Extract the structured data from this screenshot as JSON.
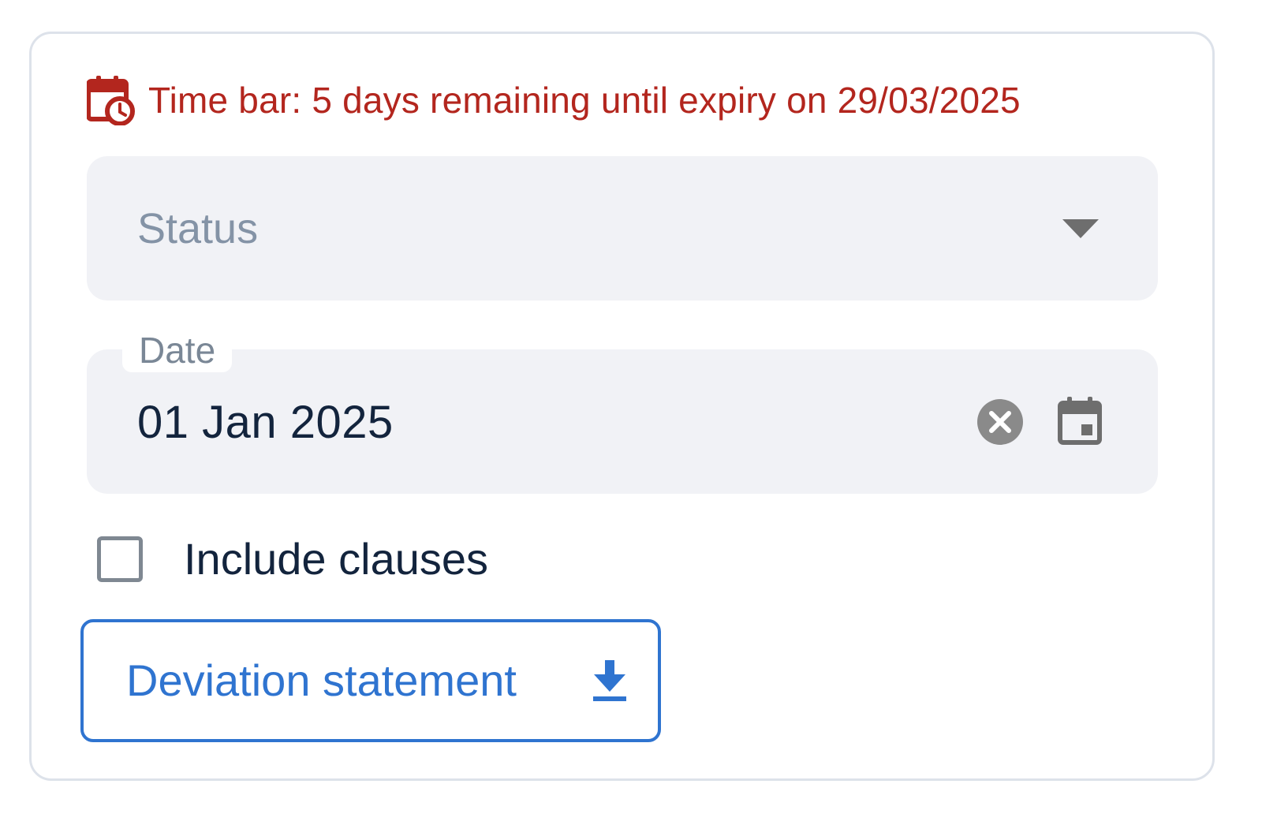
{
  "timebar": {
    "text": "Time bar: 5 days remaining until expiry on 29/03/2025",
    "icon": "calendar-clock-icon",
    "color": "#b3261e"
  },
  "status_field": {
    "placeholder": "Status",
    "icon": "chevron-down-icon"
  },
  "date_field": {
    "label": "Date",
    "value": "01 Jan 2025",
    "clear_icon": "clear-icon",
    "calendar_icon": "calendar-icon"
  },
  "include_clauses": {
    "label": "Include clauses",
    "checked": false
  },
  "download_button": {
    "label": "Deviation statement",
    "icon": "download-icon",
    "color": "#2f74d0"
  }
}
